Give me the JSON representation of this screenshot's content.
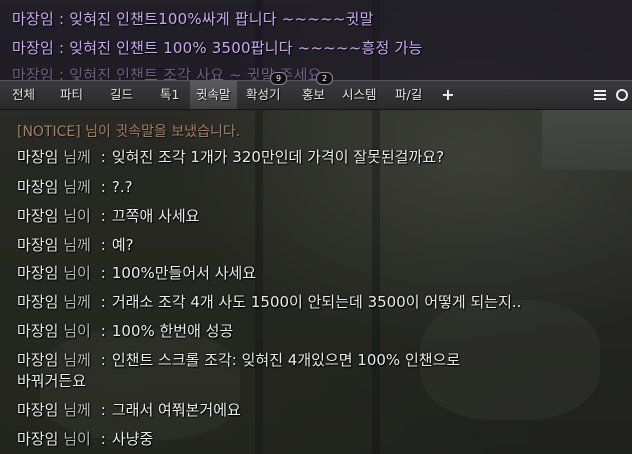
{
  "top_chat": {
    "lines": [
      {
        "text": "마장임 : 잊혀진 인챈트100%싸게 팝니다 ~~~~~귓말"
      },
      {
        "text": "마장임 : 잊혀진 인챈트 100% 3500팝니다 ~~~~~흥정 가능"
      },
      {
        "text": "마장임 : 잊혀진 인챈트 조각 사요 ~ 귓말 주세요"
      }
    ]
  },
  "tabs": [
    {
      "label": "전체"
    },
    {
      "label": "파티"
    },
    {
      "label": "길드"
    },
    {
      "label": "톡1"
    },
    {
      "label": "귓속말",
      "active": true
    },
    {
      "label": "확성기",
      "badge": "9"
    },
    {
      "label": "홍보",
      "badge": "2"
    },
    {
      "label": "시스템"
    },
    {
      "label": "파/길"
    }
  ],
  "tab_icons": {
    "add": "plus-icon",
    "menu": "menu-icon",
    "settings": "gear-icon"
  },
  "notice_text": "[NOTICE] 님이 귓속말을 보냈습니다.",
  "messages": [
    {
      "sender": "마장임",
      "suffix": "님께",
      "colon": ":",
      "text": "잊혀진 조각 1개가 320만인데 가격이 잘못된걸까요?"
    },
    {
      "sender": "마장임",
      "suffix": "님께",
      "colon": ":",
      "text": "?.?"
    },
    {
      "sender": "마장임",
      "suffix": "님이",
      "colon": ":",
      "text": "끄쪽애 사세요"
    },
    {
      "sender": "마장임",
      "suffix": "님께",
      "colon": ":",
      "text": "예?"
    },
    {
      "sender": "마장임",
      "suffix": "님이",
      "colon": ":",
      "text": "100%만들어서 사세요"
    },
    {
      "sender": "마장임",
      "suffix": "님께",
      "colon": ":",
      "text": "거래소 조각 4개 사도 1500이 안되는데 3500이 어떻게 되는지.."
    },
    {
      "sender": "마장임",
      "suffix": "님이",
      "colon": ":",
      "text": "100% 한번애 성공"
    },
    {
      "sender": "마장임",
      "suffix": "님께",
      "colon": ":",
      "text": "인챈트 스크롤 조각: 잊혀진 4개있으면 100% 인챈으로",
      "continuation": "바꿔거든요"
    },
    {
      "sender": "마장임",
      "suffix": "님께",
      "colon": ":",
      "text": "그래서 여쭤본거에요"
    },
    {
      "sender": "마장임",
      "suffix": "님이",
      "colon": ":",
      "text": "사냥중"
    }
  ],
  "colors": {
    "top_chat_text": "#c9a7f4",
    "chat_text": "#ececec",
    "suffix_text": "#b9b9b9"
  }
}
